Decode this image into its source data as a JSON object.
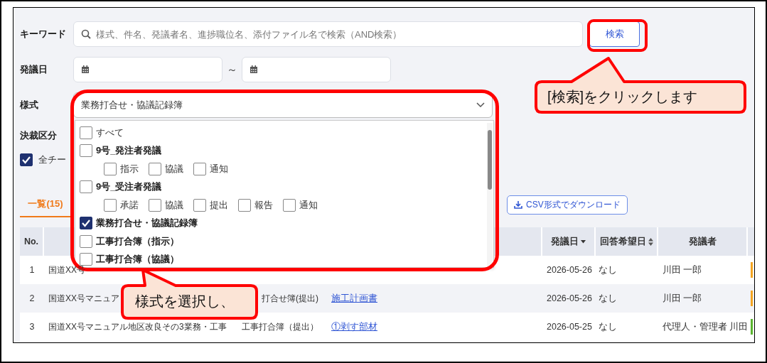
{
  "search_form": {
    "keyword": {
      "label": "キーワード",
      "placeholder": "様式、件名、発議者名、進捗職位名、添付ファイル名で検索（AND検索）",
      "button": "検索"
    },
    "date": {
      "label": "発議日",
      "separator": "～"
    },
    "style": {
      "label": "様式",
      "value": "業務打合せ・協議記録簿",
      "expanded": true,
      "options": [
        {
          "kind": "all",
          "label": "すべて",
          "checked": false
        },
        {
          "kind": "group",
          "label": "9号_発注者発議",
          "checked": false,
          "children": [
            {
              "label": "指示",
              "checked": false
            },
            {
              "label": "協議",
              "checked": false
            },
            {
              "label": "通知",
              "checked": false
            }
          ]
        },
        {
          "kind": "group",
          "label": "9号_受注者発議",
          "checked": false,
          "children": [
            {
              "label": "承諾",
              "checked": false
            },
            {
              "label": "協議",
              "checked": false
            },
            {
              "label": "提出",
              "checked": false
            },
            {
              "label": "報告",
              "checked": false
            },
            {
              "label": "通知",
              "checked": false
            }
          ]
        },
        {
          "kind": "group",
          "label": "業務打合せ・協議記録簿",
          "checked": true
        },
        {
          "kind": "group",
          "label": "工事打合簿（指示）",
          "checked": false
        },
        {
          "kind": "group",
          "label": "工事打合簿（協議）",
          "checked": false
        }
      ]
    },
    "approval": {
      "label": "決裁区分",
      "all_teams": {
        "label": "全チー",
        "checked": true
      }
    }
  },
  "tabs": [
    {
      "label": "一覧(15)",
      "selected": true
    }
  ],
  "csv_button": "CSV形式でダウンロード",
  "table": {
    "columns": [
      {
        "label": "No."
      },
      {
        "label": "発議日",
        "kind": "sorted"
      },
      {
        "label": "回答希望日",
        "kind": "sortable"
      },
      {
        "label": "発議者"
      }
    ],
    "rows": [
      {
        "no": "1",
        "subject": "国道XX号",
        "date": "2026-05-26",
        "reply": "なし",
        "issuer": "川田 一郎",
        "color": "#f5a623"
      },
      {
        "no": "2",
        "subject": "国道XX号マニュア",
        "kind": "打合せ簿(提出)",
        "attachment": "施工計画書",
        "date": "2026-05-26",
        "reply": "なし",
        "issuer": "川田 一郎",
        "color": "#f5a623"
      },
      {
        "no": "3",
        "subject": "国道XX号マニュアル地区改良その3業務・工事",
        "kind": "工事打合簿（提出）",
        "attachment": "①剥す部材",
        "date": "2026-05-25",
        "reply": "なし",
        "issuer": "代理人・管理者 川田",
        "color": "#5cb531"
      }
    ]
  },
  "annotations": [
    {
      "text": "[検索]をクリックします"
    },
    {
      "text": "様式を選択し、"
    }
  ]
}
